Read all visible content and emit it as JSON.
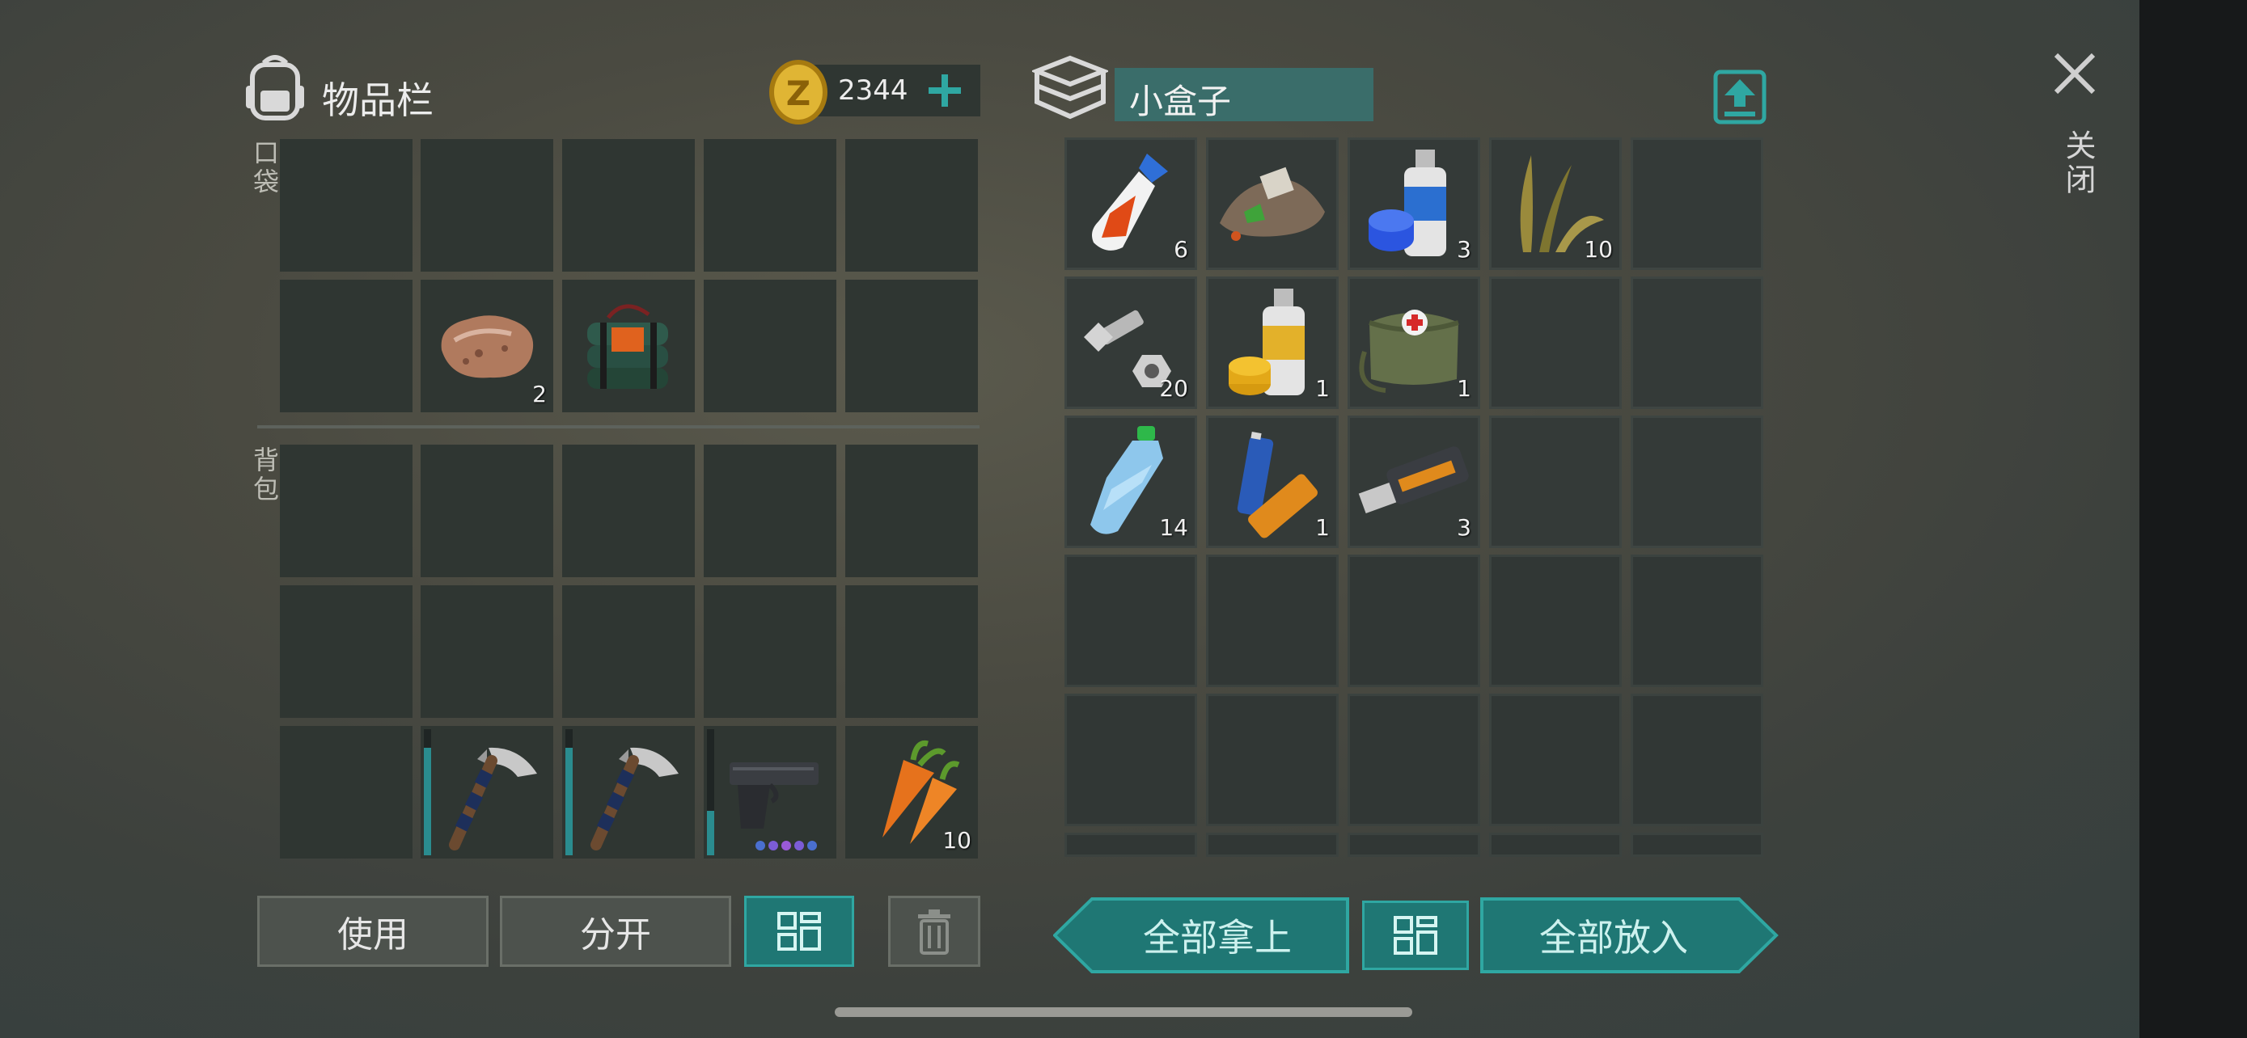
{
  "inventory": {
    "title": "物品栏",
    "coins": "2344",
    "pocket_label": "口袋",
    "backpack_label": "背包",
    "pocket_items": [
      {
        "slot": 6,
        "icon": "rock-icon",
        "qty": "2"
      },
      {
        "slot": 7,
        "icon": "explosive-pack-icon",
        "qty": ""
      }
    ],
    "backpack_items": [
      {
        "slot": 11,
        "icon": "pickaxe-icon",
        "qty": "",
        "durability": 0.85
      },
      {
        "slot": 12,
        "icon": "pickaxe-icon",
        "qty": "",
        "durability": 0.85
      },
      {
        "slot": 13,
        "icon": "pistol-icon",
        "qty": "",
        "durability": 0.35,
        "ammo_dots": 5
      },
      {
        "slot": 14,
        "icon": "carrot-icon",
        "qty": "10"
      }
    ]
  },
  "container": {
    "title": "小盒子",
    "items": [
      {
        "slot": 0,
        "icon": "glue-icon",
        "qty": "6"
      },
      {
        "slot": 1,
        "icon": "scrap-pile-icon",
        "qty": ""
      },
      {
        "slot": 2,
        "icon": "blue-spray-paint-icon",
        "qty": "3"
      },
      {
        "slot": 3,
        "icon": "plant-fiber-icon",
        "qty": "10"
      },
      {
        "slot": 5,
        "icon": "bolt-nut-icon",
        "qty": "20"
      },
      {
        "slot": 6,
        "icon": "yellow-spray-paint-icon",
        "qty": "1"
      },
      {
        "slot": 7,
        "icon": "first-aid-bag-icon",
        "qty": "1"
      },
      {
        "slot": 10,
        "icon": "water-bottle-icon",
        "qty": "14"
      },
      {
        "slot": 11,
        "icon": "battery-icon",
        "qty": "1"
      },
      {
        "slot": 12,
        "icon": "usb-drive-icon",
        "qty": "3"
      }
    ]
  },
  "buttons": {
    "use": "使用",
    "split": "分开",
    "take_all": "全部拿上",
    "put_all": "全部放入"
  },
  "close_label": "关闭",
  "colors": {
    "accent": "#2fa7a2",
    "teal_fill": "#1f7774",
    "slot": "#2f3632"
  }
}
